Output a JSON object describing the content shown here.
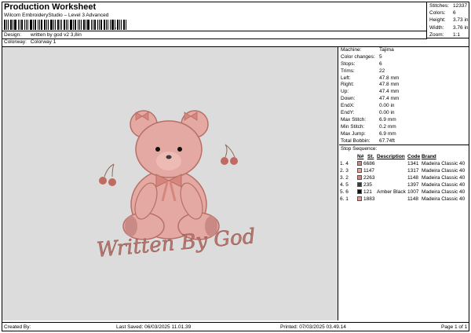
{
  "header": {
    "title": "Production Worksheet",
    "subtitle": "Wilcom EmbroideryStudio – Level 3 Advanced",
    "barcode_suffix": ",",
    "design_label": "Design:",
    "design_value": "written by god v2 3,8in",
    "colorway_label": "Colorway:",
    "colorway_value": "Colorway 1"
  },
  "stats": [
    {
      "label": "Stitches:",
      "value": "12337"
    },
    {
      "label": "Colors:",
      "value": "6"
    },
    {
      "label": "Height:",
      "value": "3.73 in"
    },
    {
      "label": "Width:",
      "value": "3.76 in"
    },
    {
      "label": "Zoom:",
      "value": "1:1"
    }
  ],
  "info": [
    {
      "label": "Machine:",
      "value": "Tajima"
    },
    {
      "label": "Color changes:",
      "value": "5"
    },
    {
      "label": "Stops:",
      "value": "6"
    },
    {
      "label": "Trims:",
      "value": "22"
    },
    {
      "label": "Left:",
      "value": "47.8 mm"
    },
    {
      "label": "Right:",
      "value": "47.8 mm"
    },
    {
      "label": "Up:",
      "value": "47.4 mm"
    },
    {
      "label": "Down:",
      "value": "47.4 mm"
    },
    {
      "label": "EndX:",
      "value": "0.00 in"
    },
    {
      "label": "EndY:",
      "value": "0.00 in"
    },
    {
      "label": "Max Stitch:",
      "value": "6.9 mm"
    },
    {
      "label": "Min Stitch:",
      "value": "0.2 mm"
    },
    {
      "label": "Max Jump:",
      "value": "6.9 mm"
    },
    {
      "label": "Total Bobbin:",
      "value": "67.74ft"
    }
  ],
  "stop_sequence": {
    "title": "Stop Sequence:",
    "headers": [
      "",
      "N#",
      "St.",
      "Description",
      "Code",
      "Brand"
    ],
    "rows": [
      {
        "stop": "1.",
        "needle": "4",
        "color": "#c98a85",
        "code_num": "6686",
        "stitches": "1341",
        "description": "",
        "brand": "Madeira Classic 40"
      },
      {
        "stop": "2.",
        "needle": "3",
        "color": "#e8a39a",
        "code_num": "1147",
        "stitches": "1317",
        "description": "",
        "brand": "Madeira Classic 40"
      },
      {
        "stop": "3.",
        "needle": "2",
        "color": "#d6867c",
        "code_num": "2263",
        "stitches": "1148",
        "description": "",
        "brand": "Madeira Classic 40"
      },
      {
        "stop": "4.",
        "needle": "5",
        "color": "#3a3a3a",
        "code_num": "235",
        "stitches": "1397",
        "description": "",
        "brand": "Madeira Classic 40"
      },
      {
        "stop": "5.",
        "needle": "6",
        "color": "#111111",
        "code_num": "121",
        "stitches": "1007",
        "description": "Amber Black",
        "brand": "Madeira Classic 40"
      },
      {
        "stop": "6.",
        "needle": "1",
        "color": "#e59a92",
        "code_num": "1883",
        "stitches": "1148",
        "description": "",
        "brand": "Madeira Classic 40"
      }
    ]
  },
  "preview": {
    "text": "Written By God",
    "bear_color": "#e3a9a2",
    "bear_shade": "#b86f66",
    "text_color": "#b8766e",
    "cherry_color": "#c06a62"
  },
  "footer": {
    "created_by": "Created By:",
    "last_saved": "Last Saved: 06/03/2025 11.01.39",
    "printed": "Printed: 07/03/2025 03.49.14",
    "page": "Page 1 of 1"
  }
}
